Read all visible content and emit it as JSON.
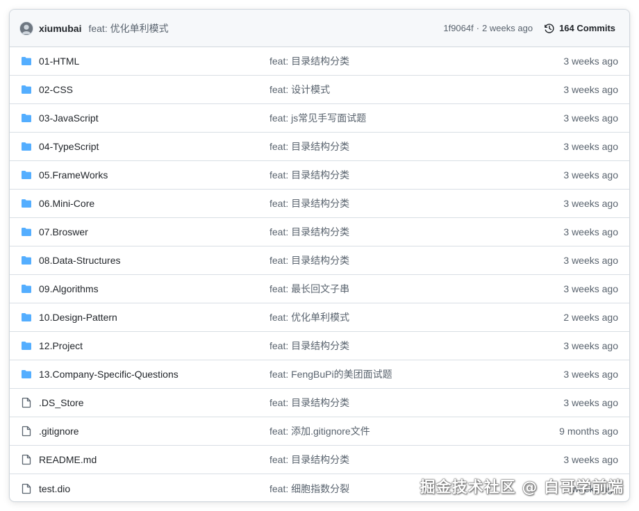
{
  "header": {
    "avatar_icon": "user-avatar",
    "author": "xiumubai",
    "message": "feat: 优化单利模式",
    "sha": "1f9064f",
    "separator": "·",
    "time": "2 weeks ago",
    "commits_icon": "history-icon",
    "commits_label": "164 Commits"
  },
  "colors": {
    "folder": "#54aeff",
    "file_icon": "#59636e",
    "header_bg": "#f6f8fa",
    "border": "#d0d7de",
    "muted_text": "#59636e"
  },
  "files": [
    {
      "type": "folder",
      "name": "01-HTML",
      "message": "feat: 目录结构分类",
      "time": "3 weeks ago"
    },
    {
      "type": "folder",
      "name": "02-CSS",
      "message": "feat: 设计模式",
      "time": "3 weeks ago"
    },
    {
      "type": "folder",
      "name": "03-JavaScript",
      "message": "feat: js常见手写面试题",
      "time": "3 weeks ago"
    },
    {
      "type": "folder",
      "name": "04-TypeScript",
      "message": "feat: 目录结构分类",
      "time": "3 weeks ago"
    },
    {
      "type": "folder",
      "name": "05.FrameWorks",
      "message": "feat: 目录结构分类",
      "time": "3 weeks ago"
    },
    {
      "type": "folder",
      "name": "06.Mini-Core",
      "message": "feat: 目录结构分类",
      "time": "3 weeks ago"
    },
    {
      "type": "folder",
      "name": "07.Broswer",
      "message": "feat: 目录结构分类",
      "time": "3 weeks ago"
    },
    {
      "type": "folder",
      "name": "08.Data-Structures",
      "message": "feat: 目录结构分类",
      "time": "3 weeks ago"
    },
    {
      "type": "folder",
      "name": "09.Algorithms",
      "message": "feat: 最长回文子串",
      "time": "3 weeks ago"
    },
    {
      "type": "folder",
      "name": "10.Design-Pattern",
      "message": "feat: 优化单利模式",
      "time": "2 weeks ago"
    },
    {
      "type": "folder",
      "name": "12.Project",
      "message": "feat: 目录结构分类",
      "time": "3 weeks ago"
    },
    {
      "type": "folder",
      "name": "13.Company-Specific-Questions",
      "message": "feat: FengBuPi的美团面试题",
      "time": "3 weeks ago"
    },
    {
      "type": "file",
      "name": ".DS_Store",
      "message": "feat: 目录结构分类",
      "time": "3 weeks ago"
    },
    {
      "type": "file",
      "name": ".gitignore",
      "message": "feat: 添加.gitignore文件",
      "time": "9 months ago"
    },
    {
      "type": "file",
      "name": "README.md",
      "message": "feat: 目录结构分类",
      "time": "3 weeks ago"
    },
    {
      "type": "file",
      "name": "test.dio",
      "message": "feat: 细胞指数分裂",
      "time": "3 weeks ago"
    }
  ],
  "watermark": "掘金技术社区 @ 白哥学前端"
}
